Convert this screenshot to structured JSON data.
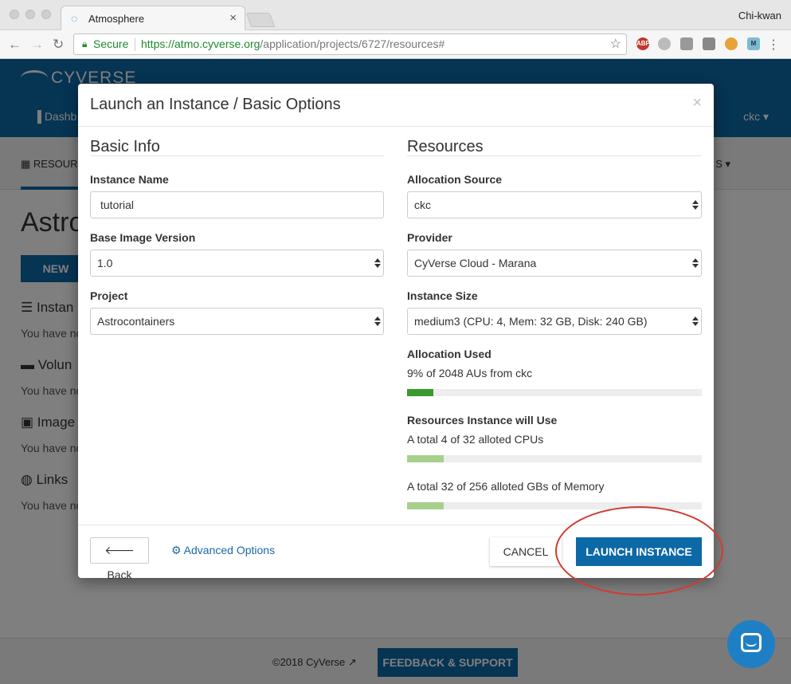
{
  "browser": {
    "tab_title": "Atmosphere",
    "tab_close": "×",
    "user": "Chi-kwan",
    "secure_label": "Secure",
    "url_host": "https://atmo.cyverse.org",
    "url_path": "/application/projects/6727/resources#",
    "extension_abp": "ABP"
  },
  "app": {
    "logo": "CYVERSE",
    "nav_dashboard": "Dashb",
    "nav_user": "ckc ▾",
    "subnav_resources": "RESOUR",
    "subnav_right": "S ▾",
    "project_title": "Astro",
    "new_button": "NEW",
    "sections": [
      {
        "title": "Instan",
        "sub": "You have no"
      },
      {
        "title": "Volun",
        "sub": "You have no"
      },
      {
        "title": "Image",
        "sub": "You have no"
      },
      {
        "title": "Links",
        "sub": "You have no"
      }
    ],
    "copyright": "©2018 CyVerse",
    "feedback_button": "FEEDBACK & SUPPORT"
  },
  "modal": {
    "title": "Launch an Instance / Basic Options",
    "close": "×",
    "basic_info": {
      "heading": "Basic Info",
      "instance_name_label": "Instance Name",
      "instance_name_value": "tutorial",
      "base_image_label": "Base Image Version",
      "base_image_value": "1.0",
      "project_label": "Project",
      "project_value": "Astrocontainers"
    },
    "resources": {
      "heading": "Resources",
      "allocation_source_label": "Allocation Source",
      "allocation_source_value": "ckc",
      "provider_label": "Provider",
      "provider_value": "CyVerse Cloud - Marana",
      "instance_size_label": "Instance Size",
      "instance_size_value": "medium3 (CPU: 4, Mem: 32 GB, Disk: 240 GB)",
      "allocation_used_label": "Allocation Used",
      "allocation_used_text": "9% of 2048 AUs from ckc",
      "allocation_used_fraction": 0.09,
      "will_use_label": "Resources Instance will Use",
      "cpu_text": "A total 4 of 32 alloted CPUs",
      "cpu_fraction": 0.125,
      "memory_text": "A total 32 of 256 alloted GBs of Memory",
      "memory_fraction": 0.125
    },
    "footer": {
      "back_button": "Back",
      "advanced_options": "Advanced Options",
      "cancel_button": "CANCEL",
      "launch_button": "LAUNCH INSTANCE"
    }
  },
  "colors": {
    "brand_blue": "#0d69a6",
    "allocation_bar": "#3a9a2e",
    "usage_bar": "#a6d08c",
    "annotation_circle": "#d23a2e"
  }
}
